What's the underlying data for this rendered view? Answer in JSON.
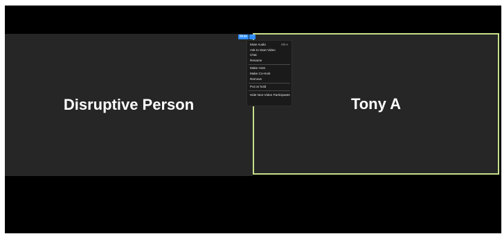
{
  "participants": {
    "left": {
      "name": "Disruptive Person"
    },
    "right": {
      "name": "Tony A",
      "active_speaker_border": "#c7e08a"
    }
  },
  "controls": {
    "mute_label": "Mute",
    "more_label": "···"
  },
  "menu": {
    "mute_audio": {
      "label": "Mute Audio",
      "shortcut": "Alt+A"
    },
    "ask_start_video": "Ask to Start Video",
    "chat": "Chat",
    "rename": "Rename",
    "make_host": "Make Host",
    "make_cohost": "Make Co-Host",
    "remove": "Remove",
    "put_on_hold": "Put on hold",
    "hide_non_video": "Hide Non-Video Participants"
  },
  "colors": {
    "accent": "#2d8cff",
    "background": "#000000",
    "tile": "#262626",
    "menu_bg": "#1a1a1a"
  }
}
